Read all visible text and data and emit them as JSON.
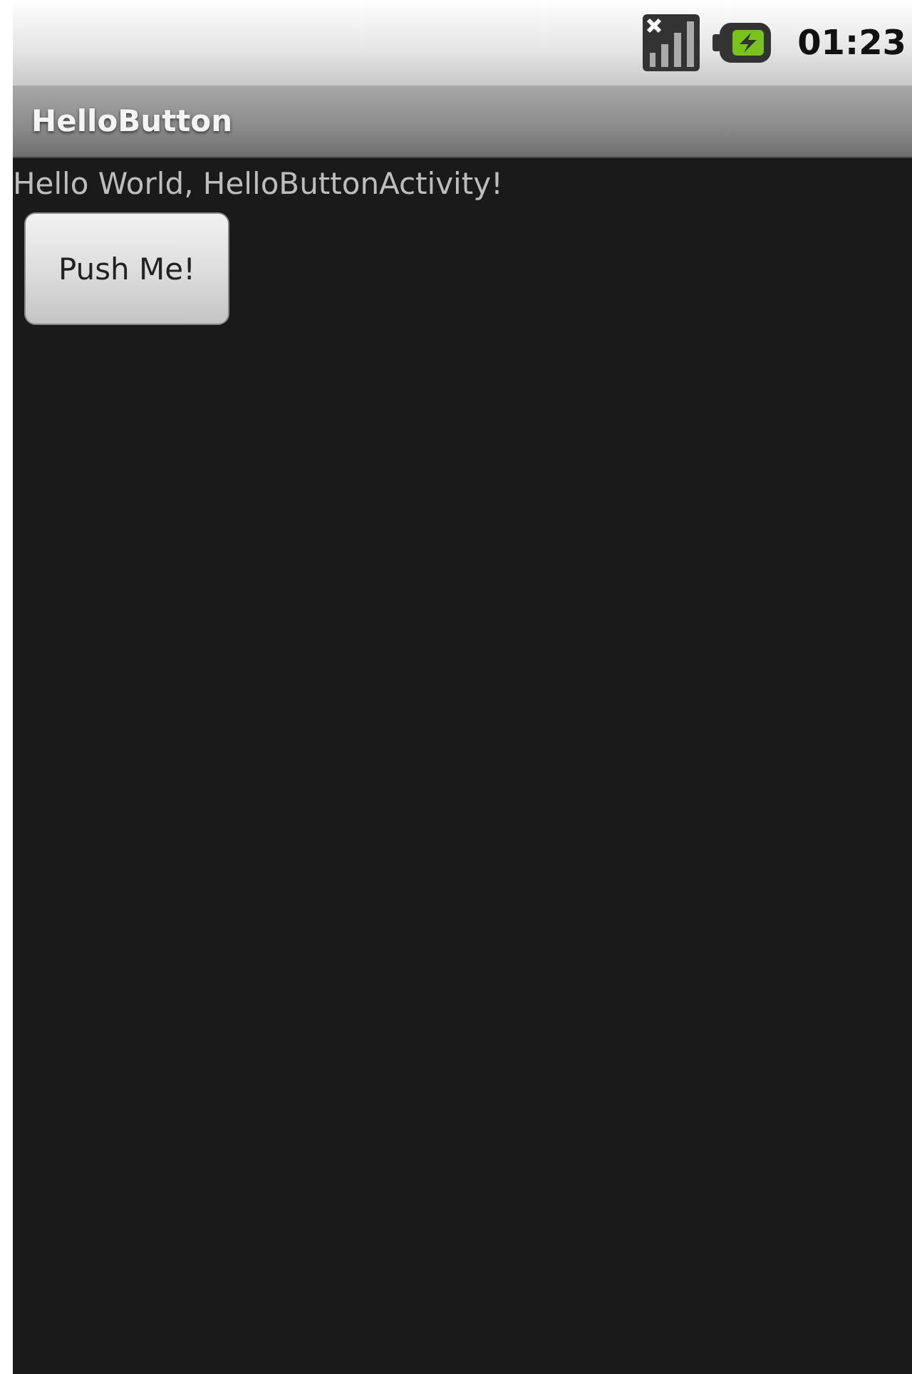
{
  "status_bar": {
    "time": "01:23"
  },
  "title_bar": {
    "title": "HelloButton"
  },
  "content": {
    "message": "Hello World, HelloButtonActivity!",
    "button": "Push Me!"
  }
}
